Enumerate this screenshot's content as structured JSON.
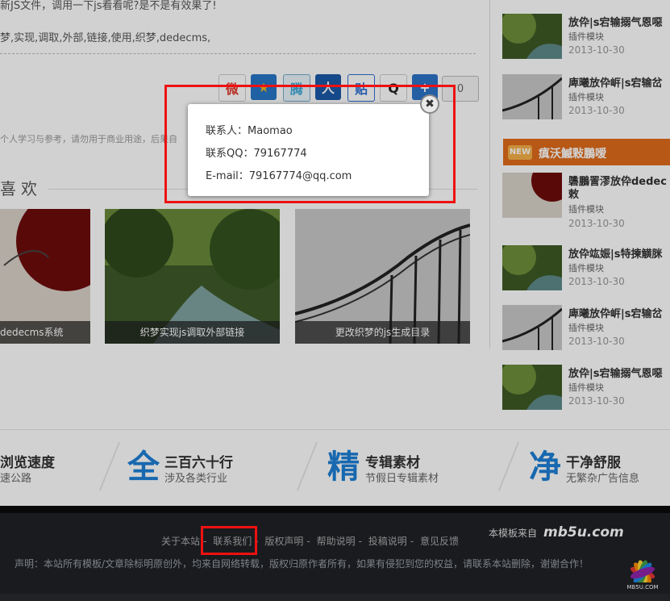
{
  "article": {
    "top_text": "新JS文件，调用一下js看看呢?是不是有效果了!",
    "tags": "梦,实现,调取,外部,链接,使用,织梦,dedecms,",
    "share_count": "0",
    "notice": "个人学习与参考，请勿用于商业用途，后果自"
  },
  "share_icons": [
    {
      "name": "weibo-icon",
      "glyph": "微",
      "color": "#e23b2e"
    },
    {
      "name": "qzone-icon",
      "glyph": "★",
      "color": "#f2a515"
    },
    {
      "name": "tencent-weibo-icon",
      "glyph": "腾",
      "color": "#3aa6d8"
    },
    {
      "name": "renren-icon",
      "glyph": "人",
      "color": "#1c5aa8"
    },
    {
      "name": "tieba-icon",
      "glyph": "贴",
      "color": "#2f6fd1"
    },
    {
      "name": "qq-icon",
      "glyph": "Q",
      "color": "#222222"
    },
    {
      "name": "more-share-icon",
      "glyph": "+",
      "color": "#2d74c9"
    }
  ],
  "like": {
    "title": "喜欢",
    "items": [
      {
        "caption": "dedecms系统"
      },
      {
        "caption": "织梦实现js调取外部链接"
      },
      {
        "caption": "更改织梦的js生成目录"
      }
    ]
  },
  "sidebar": {
    "top_items": [
      {
        "title": "放伜|s宕输搦气恩噁",
        "category": "插件模块",
        "date": "2013-10-30"
      },
      {
        "title": "庳曦放伜㟁|s宕输岔",
        "category": "插件模块",
        "date": "2013-10-30"
      }
    ],
    "section_badge": "NEW",
    "section_title": "瘨沃鰄敤鵬嗳",
    "items": [
      {
        "title": "䃧鵬詈漻放伜dedec",
        "title2": "敕",
        "category": "插件模块",
        "date": "2013-10-30"
      },
      {
        "title": "放伜竑娠|s特揀觵脒",
        "category": "插件模块",
        "date": "2013-10-30"
      },
      {
        "title": "庳曦放伜㟁|s宕输岔",
        "category": "插件模块",
        "date": "2013-10-30"
      },
      {
        "title": "放伜|s宕输搦气恩噁",
        "category": "插件模块",
        "date": "2013-10-30"
      }
    ]
  },
  "features": [
    {
      "big": "",
      "title": "浏览速度",
      "sub": "速公路"
    },
    {
      "big": "全",
      "title": "三百六十行",
      "sub": "涉及各类行业"
    },
    {
      "big": "精",
      "title": "专辑素材",
      "sub": "节假日专辑素材"
    },
    {
      "big": "净",
      "title": "干净舒服",
      "sub": "无繁杂广告信息"
    }
  ],
  "footer": {
    "links": [
      "关于本站",
      "联系我们",
      "版权声明",
      "帮助说明",
      "投稿说明",
      "意见反馈"
    ],
    "separator": "-",
    "declaration": "声明：本站所有模板/文章除标明原创外，均来自网络转载，版权归原作者所有，如果有侵犯到您的权益，请联系本站删除，谢谢合作！",
    "source_text": "本模板来自",
    "source_brand": "mb5u.com",
    "logo_text": "MB5U.COM"
  },
  "popup": {
    "contact_label": "联系人：",
    "contact_value": "Maomao",
    "qq_label": "联系QQ：",
    "qq_value": "79167774",
    "email_label": "E-mail：",
    "email_value": "79167774@qq.com",
    "close_glyph": "✖"
  },
  "colors": {
    "accent": "#1d7fd6",
    "highlight": "#ee1111",
    "new_bar": "#e06c1b"
  }
}
